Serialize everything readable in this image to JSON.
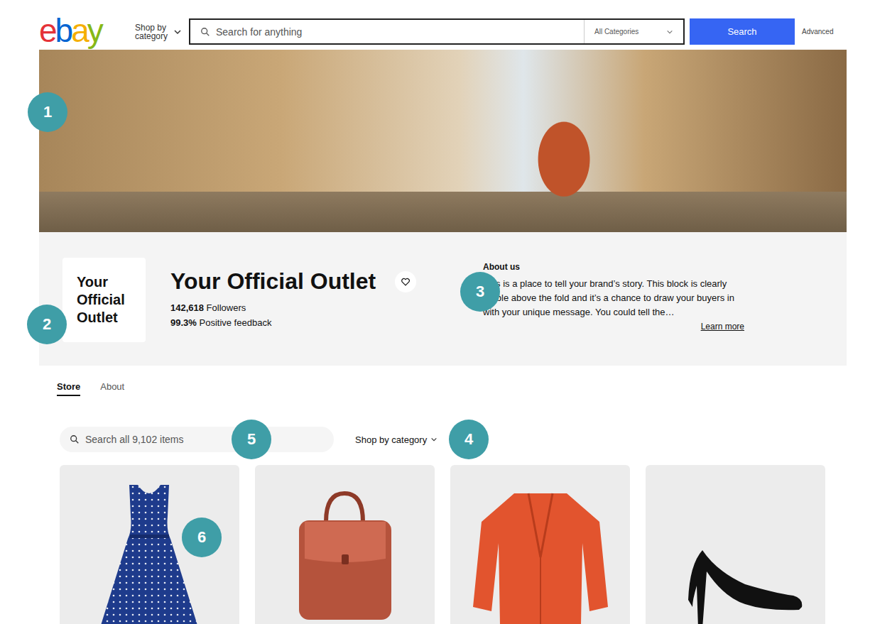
{
  "header": {
    "logo": "ebay",
    "shop_by_category": "Shop by category",
    "search_placeholder": "Search for anything",
    "category_select": "All Categories",
    "search_button": "Search",
    "advanced": "Advanced"
  },
  "store": {
    "logo_text": "Your Official Outlet",
    "name": "Your Official Outlet",
    "followers_count": "142,618",
    "followers_label": "Followers",
    "feedback_percent": "99.3%",
    "feedback_label": "Positive feedback",
    "following": false
  },
  "about": {
    "title": "About us",
    "text": "This is a place to tell your brand’s story. This block is clearly visible above the fold and it’s a chance to draw your buyers in with your unique message. You could tell the…",
    "link": "Learn more"
  },
  "tabs": [
    {
      "label": "Store",
      "selected": true
    },
    {
      "label": "About",
      "selected": false
    }
  ],
  "store_search": {
    "placeholder": "Search all 9,102 items"
  },
  "category_dropdown": {
    "label": "Shop by category"
  },
  "products": [
    {
      "kind": "dress"
    },
    {
      "kind": "backpack"
    },
    {
      "kind": "cardigan"
    },
    {
      "kind": "heels"
    }
  ],
  "callouts": [
    "1",
    "2",
    "3",
    "4",
    "5",
    "6"
  ]
}
